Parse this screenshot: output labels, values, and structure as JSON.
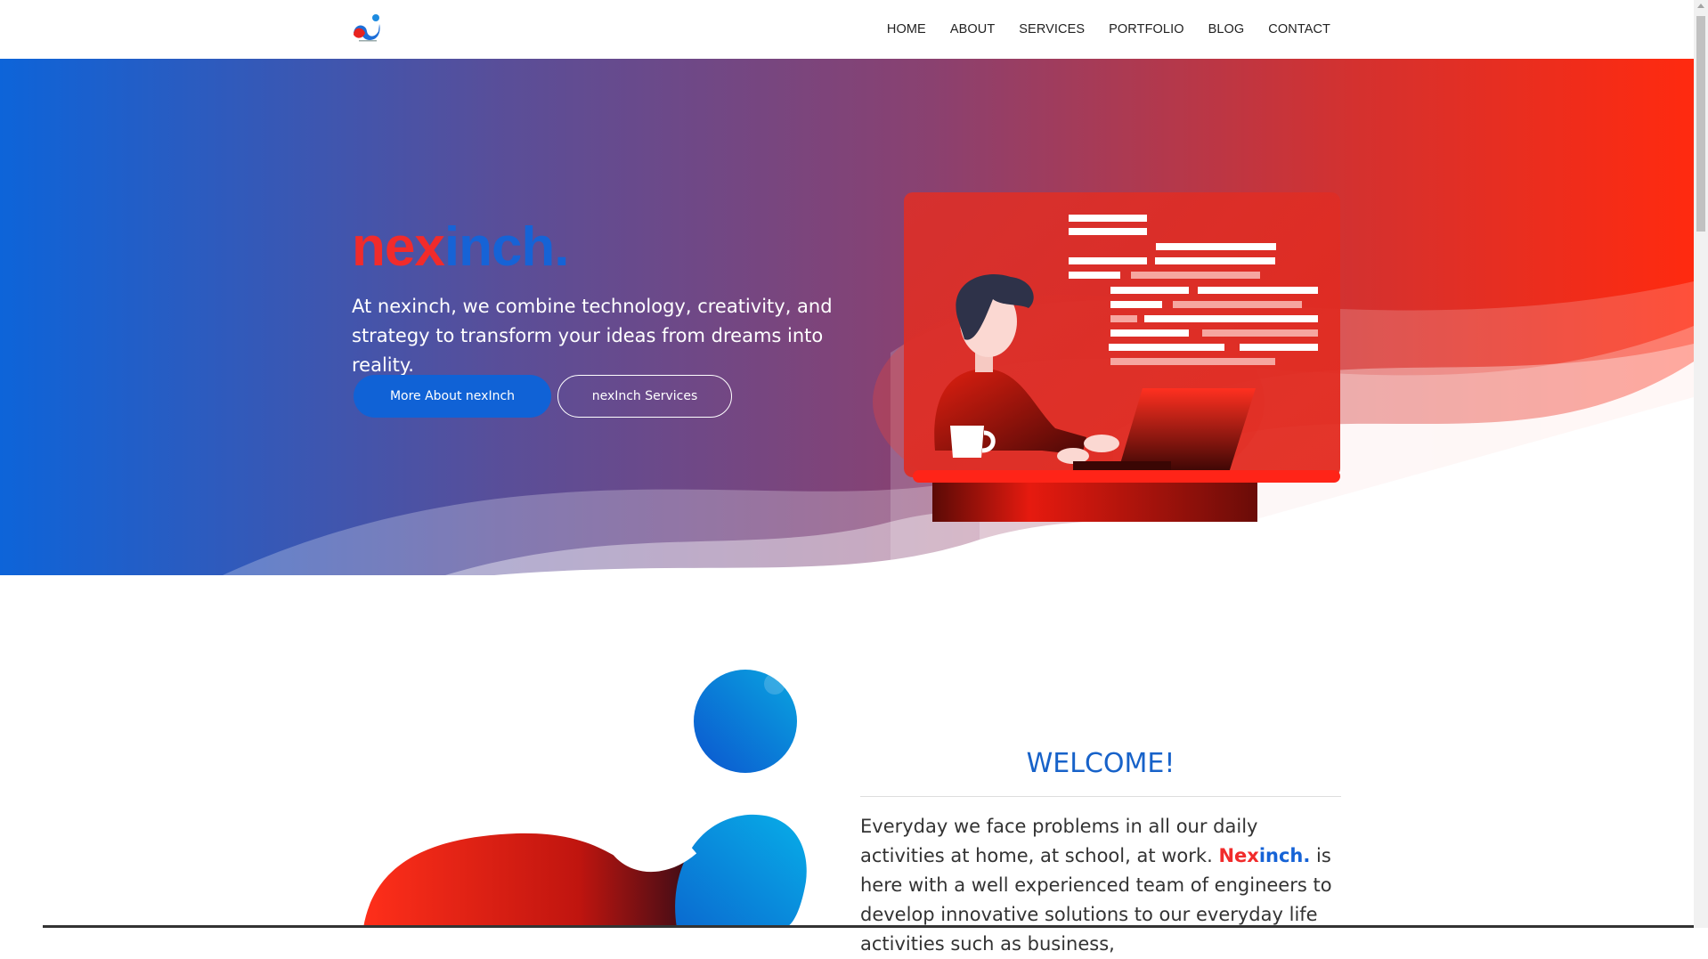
{
  "header": {
    "logo_icon": "nexinch-logo-icon",
    "nav": [
      {
        "label": "HOME"
      },
      {
        "label": "ABOUT"
      },
      {
        "label": "SERVICES"
      },
      {
        "label": "PORTFOLIO"
      },
      {
        "label": "BLOG"
      },
      {
        "label": "CONTACT"
      }
    ]
  },
  "hero": {
    "title_part1": "nex",
    "title_part2": "inch.",
    "text": "At nexinch, we combine technology, creativity, and strategy to transform your ideas from dreams into reality.",
    "primary_button": "More About nexInch",
    "secondary_button": "nexInch Services",
    "illustration": "person-at-laptop-illustration"
  },
  "welcome": {
    "heading": "WELCOME!",
    "text_before": "Everyday we face problems in all our daily activities at home, at school, at work.",
    "brand_nex": "Nex",
    "brand_inch": "inch.",
    "text_after": "is here with a well experienced team of engineers to develop innovative solutions to our everyday life activities such as business,"
  },
  "colors": {
    "brand_red": "#f12b2b",
    "brand_blue": "#1663d6",
    "hero_gradient_left": "#0d64d9",
    "hero_gradient_right": "#ff2a0f"
  }
}
